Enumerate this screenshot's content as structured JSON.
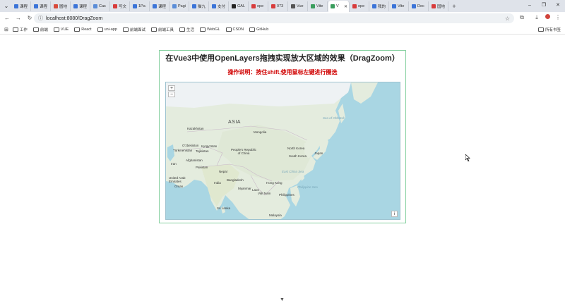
{
  "tabs": [
    {
      "label": "课程",
      "color": "#3b74d8"
    },
    {
      "label": "课程",
      "color": "#3b74d8"
    },
    {
      "label": "圆地",
      "color": "#d84a3b"
    },
    {
      "label": "课程",
      "color": "#3b74d8"
    },
    {
      "label": "Cas",
      "color": "#5a8dd8"
    },
    {
      "label": "写文",
      "color": "#d83b3b"
    },
    {
      "label": "1Pa",
      "color": "#3b74d8"
    },
    {
      "label": "课程",
      "color": "#3b74d8"
    },
    {
      "label": "Pagi",
      "color": "#5a8dd8"
    },
    {
      "label": "猫九",
      "color": "#3b74d8"
    },
    {
      "label": "支付",
      "color": "#3b74d8"
    },
    {
      "label": "GAL",
      "color": "#222222"
    },
    {
      "label": "ope",
      "color": "#d83b3b"
    },
    {
      "label": "073",
      "color": "#d83b3b"
    },
    {
      "label": "Vue",
      "color": "#555555"
    },
    {
      "label": "Vite",
      "color": "#3a9d5d"
    },
    {
      "label": "V",
      "color": "#3a9d5d",
      "active": true
    },
    {
      "label": "ope",
      "color": "#d83b3b"
    },
    {
      "label": "我的",
      "color": "#3b74d8"
    },
    {
      "label": "Vite",
      "color": "#3b74d8"
    },
    {
      "label": "Dec",
      "color": "#3b74d8"
    },
    {
      "label": "国地",
      "color": "#d83b3b"
    }
  ],
  "address": {
    "url": "localhost:8080/DragZoom"
  },
  "bookmarks": [
    "工作",
    "前端",
    "VUE",
    "React",
    "uni-app",
    "前端面试",
    "前端工具",
    "生活",
    "WebGL",
    "CSDN",
    "GitHub"
  ],
  "bookmarks_all": "所有书签",
  "page": {
    "title": "在Vue3中使用OpenLayers拖拽实现放大区域的效果（DragZoom）",
    "subtitle": "操作说明：按住shift,使用鼠标左键进行圈选"
  },
  "map": {
    "zoom_in": "+",
    "zoom_out": "−",
    "attribution": "i",
    "labels": {
      "asia": "ASIA",
      "kazakhstan": "Kazakhstan",
      "mongolia": "Mongolia",
      "uzbekistan": "O'zbekiston",
      "kyrgyzstan": "Kyrgyzstan",
      "turkmenistan": "Türkmenistan",
      "tajikistan": "Tajikistan",
      "china": "People's Republic of China",
      "north_korea": "North Korea",
      "south_korea": "South Korea",
      "japan": "Japan",
      "afghanistan": "Afghanistan",
      "pakistan": "Pakistan",
      "iran": "Iran",
      "nepal": "Nepal",
      "india": "India",
      "bangladesh": "Bangladesh",
      "myanmar": "Myanmar",
      "laos": "Laos",
      "vietnam": "Việt Nam",
      "hong_kong": "Hong Kong",
      "philippines": "Philippines",
      "sri_lanka": "Sri Lanka",
      "malaysia": "Malaysia",
      "emirates": "United Arab Emirates",
      "oman": "Oman",
      "east_china_sea": "East China Sea",
      "philippine_sea": "Philippine Sea",
      "sea_of_okhotsk": "Sea of Okhotsk"
    }
  }
}
